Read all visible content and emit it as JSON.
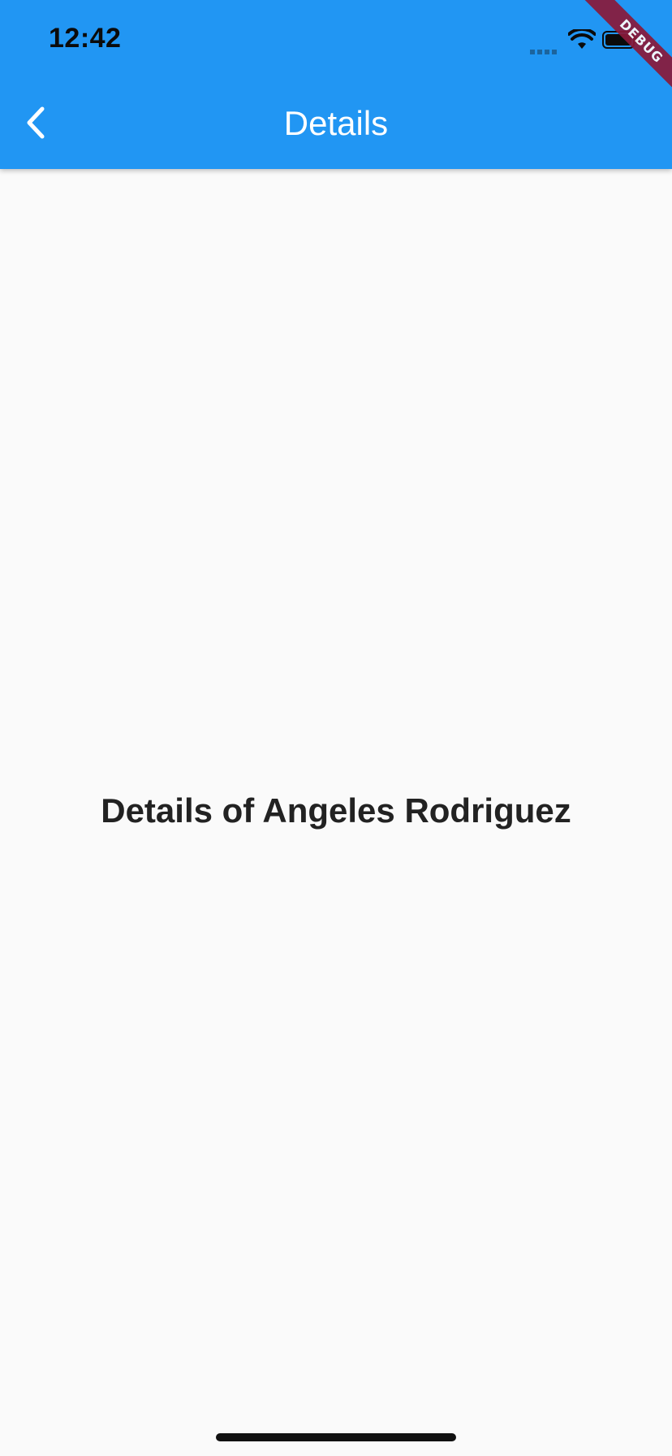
{
  "status_bar": {
    "time": "12:42"
  },
  "app_bar": {
    "title": "Details",
    "back_icon": "chevron-left-icon",
    "color": "#2196f3"
  },
  "debug_banner": {
    "label": "DEBUG"
  },
  "body": {
    "detail_text": "Details of Angeles Rodriguez"
  }
}
